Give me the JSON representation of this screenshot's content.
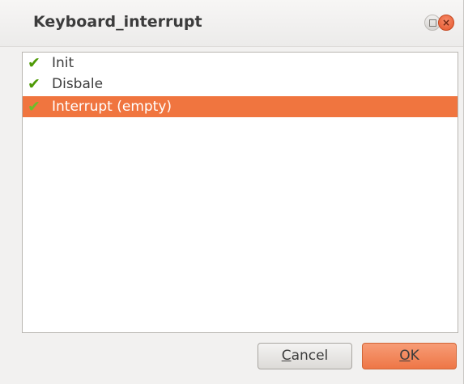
{
  "window": {
    "title": "Keyboard_interrupt",
    "close_glyph": "×"
  },
  "list": {
    "items": [
      {
        "label": "Init",
        "checked": true,
        "selected": false
      },
      {
        "label": "Disbale",
        "checked": true,
        "selected": false
      },
      {
        "label": "Interrupt (empty)",
        "checked": true,
        "selected": true
      }
    ],
    "check_glyph": "✔",
    "check_icon": "check-icon",
    "selection_color": "#f0753f",
    "check_color": "#4e9a06"
  },
  "buttons": {
    "cancel": {
      "mnemonic": "C",
      "rest": "ancel"
    },
    "ok": {
      "mnemonic": "O",
      "rest": "K"
    }
  },
  "colors": {
    "accent": "#f0753f",
    "close_button": "#e4572d"
  }
}
